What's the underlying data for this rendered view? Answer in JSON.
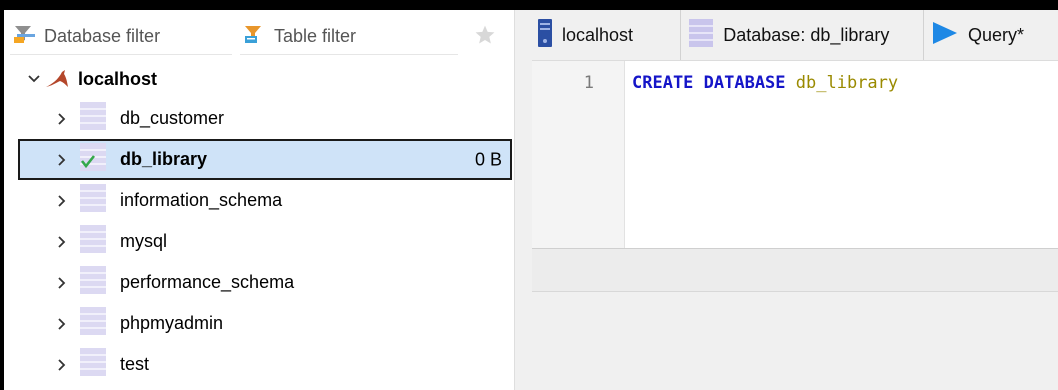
{
  "filters": {
    "database_placeholder": "Database filter",
    "table_placeholder": "Table filter"
  },
  "tree": {
    "root": {
      "label": "localhost",
      "expanded": true
    },
    "databases": [
      {
        "name": "db_customer",
        "selected": false,
        "size": ""
      },
      {
        "name": "db_library",
        "selected": true,
        "size": "0 B"
      },
      {
        "name": "information_schema",
        "selected": false,
        "size": ""
      },
      {
        "name": "mysql",
        "selected": false,
        "size": ""
      },
      {
        "name": "performance_schema",
        "selected": false,
        "size": ""
      },
      {
        "name": "phpmyadmin",
        "selected": false,
        "size": ""
      },
      {
        "name": "test",
        "selected": false,
        "size": ""
      }
    ]
  },
  "tabs": [
    {
      "label": "localhost",
      "icon": "server-icon"
    },
    {
      "label": "Database: db_library",
      "icon": "database-icon"
    },
    {
      "label": "Query*",
      "icon": "play-icon"
    }
  ],
  "editor": {
    "line_number": "1",
    "keyword": "CREATE DATABASE",
    "identifier": "db_library"
  },
  "colors": {
    "selection": "#cfe3f8",
    "keyword": "#1515c8",
    "identifier": "#9a8a00",
    "play": "#1e88e5"
  }
}
